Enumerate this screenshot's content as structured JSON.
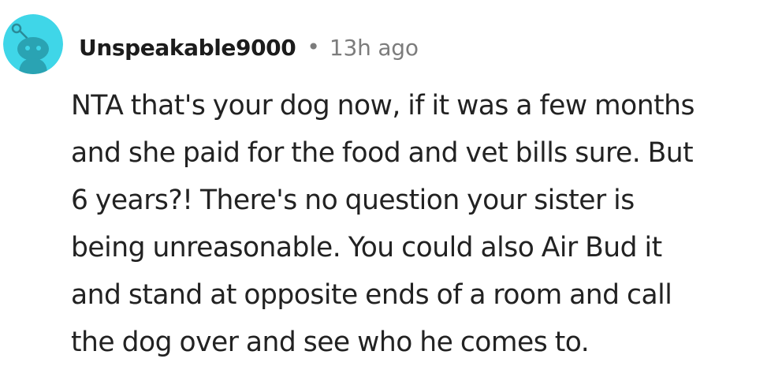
{
  "comment": {
    "author": "Unspeakable9000",
    "separator": "•",
    "timestamp": "13h ago",
    "avatar_icon": "reddit-snoo-avatar-icon",
    "avatar_color": "#3fd6e8",
    "body_lines": [
      "NTA that's your dog now, if it was a few months",
      "and she paid for the food and vet bills sure. But",
      "6 years?! There's no question your sister is",
      "being unreasonable. You could also Air Bud it",
      "and stand at opposite ends of a room and call",
      "the dog over and see who he comes to."
    ]
  }
}
